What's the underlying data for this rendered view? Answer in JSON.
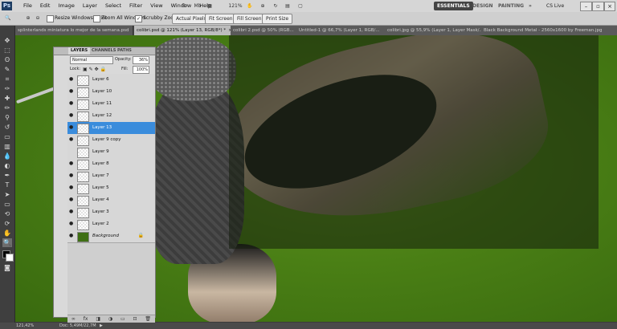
{
  "menubar": {
    "logo": "Ps",
    "items": [
      "File",
      "Edit",
      "Image",
      "Layer",
      "Select",
      "Filter",
      "View",
      "Window",
      "Help"
    ],
    "zoom": "121%",
    "workspaces": [
      "ESSENTIALS",
      "DESIGN",
      "PAINTING"
    ],
    "more": "»",
    "cs_live": "CS Live"
  },
  "options": {
    "resize_windows": "Resize Windows To Fit",
    "zoom_all": "Zoom All Windows",
    "scrubby": "Scrubby Zoom",
    "actual_pixels": "Actual Pixels",
    "fit_screen": "Fit Screen",
    "fill_screen": "Fill Screen",
    "print_size": "Print Size"
  },
  "tabs": [
    "splinterlands miniatura lo mejor de la semana.psd",
    "colibri.psd @ 121% (Layer 13, RGB/8*) *",
    "colibri 2.psd @ 50% (RGB...",
    "Untitled-1 @ 66,7% (Layer 1, RGB/...",
    "colibri.jpg @ 55,9% (Layer 1, Layer Mask/...",
    "Black Background Metal - 2560x1600 by Freeman.jpg"
  ],
  "layers_panel": {
    "tabs": [
      "LAYERS",
      "CHANNELS",
      "PATHS"
    ],
    "blend_mode": "Normal",
    "opacity_label": "Opacity:",
    "opacity": "36%",
    "lock_label": "Lock:",
    "fill_label": "Fill:",
    "fill": "100%",
    "layers": [
      {
        "name": "Layer 6",
        "visible": true
      },
      {
        "name": "Layer 10",
        "visible": true
      },
      {
        "name": "Layer 11",
        "visible": true
      },
      {
        "name": "Layer 12",
        "visible": true
      },
      {
        "name": "Layer 13",
        "visible": true,
        "selected": true
      },
      {
        "name": "Layer 9 copy",
        "visible": true
      },
      {
        "name": "Layer 9",
        "visible": false
      },
      {
        "name": "Layer 8",
        "visible": true
      },
      {
        "name": "Layer 7",
        "visible": true
      },
      {
        "name": "Layer 5",
        "visible": true
      },
      {
        "name": "Layer 4",
        "visible": true
      },
      {
        "name": "Layer 3",
        "visible": true
      },
      {
        "name": "Layer 2",
        "visible": true
      },
      {
        "name": "Background",
        "visible": true,
        "background": true
      }
    ]
  },
  "status": {
    "zoom": "121,42%",
    "doc": "Doc: 5,49M/22,7M"
  },
  "icons": {
    "eye": "👁",
    "lock": "🔒"
  }
}
